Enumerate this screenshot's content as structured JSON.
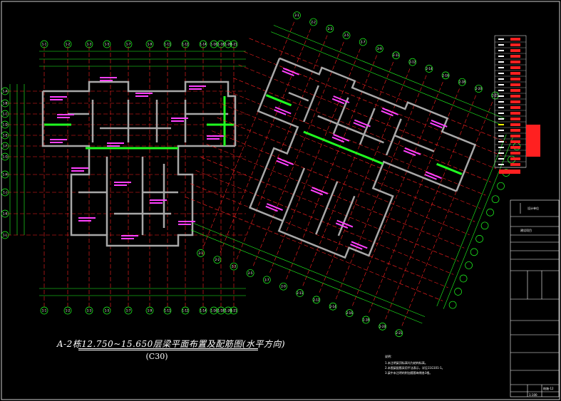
{
  "drawing": {
    "title": "A-2栋12.750~15.650层梁平面布置及配筋图(水平方向)",
    "subtitle": "(C30)",
    "colors": {
      "background": "#000000",
      "beam_red": "#ff2020",
      "label_magenta": "#ff40ff",
      "axis_green": "#20ff20",
      "wall_gray": "#a8a8a8",
      "text_white": "#ffffff",
      "yellow": "#ffff00",
      "cyan": "#20ffff"
    }
  },
  "left_axes_top": [
    "1-1",
    "1-2",
    "1-3",
    "1-5",
    "1-7",
    "1-9",
    "1-11",
    "1-12",
    "1-14",
    "1-16",
    "1-18",
    "1-20",
    "1-21"
  ],
  "left_axes_side": [
    "1-A",
    "1-B",
    "1-C",
    "1-D",
    "1-E",
    "1-F",
    "1-G",
    "1-H",
    "1-J",
    "1-K",
    "1-L"
  ],
  "right_axes": [
    "2-1",
    "2-2",
    "2-3",
    "2-5",
    "2-7",
    "2-9",
    "2-11",
    "2-12",
    "2-14",
    "2-16",
    "2-18",
    "2-20",
    "2-21"
  ],
  "notes_header": "说明：",
  "notes": [
    "1.未注明梁顶标高均为结构标高。",
    "2.本图梁配筋采用平法表示，详见11G101-1。",
    "3.梁中未注明的附加箍筋每侧各3根。"
  ],
  "title_block": {
    "company": "设计单位",
    "project": "建设项目",
    "drawing_no": "结施-12",
    "scale": "1:100"
  }
}
